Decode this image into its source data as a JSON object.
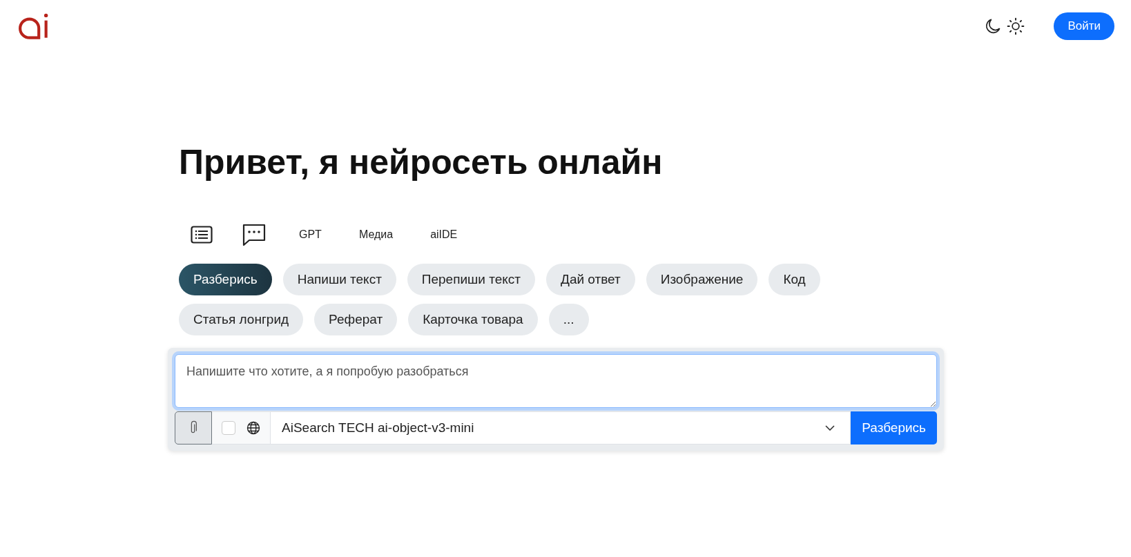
{
  "header": {
    "login_button": "Войти"
  },
  "heading": "Привет, я нейросеть онлайн",
  "mode_tabs": [
    {
      "kind": "list",
      "selected": false
    },
    {
      "kind": "chat",
      "selected": false
    },
    {
      "kind": "text",
      "label": "GPT",
      "selected": false
    },
    {
      "kind": "text",
      "label": "Медиа",
      "selected": false
    },
    {
      "kind": "text",
      "label": "aiIDE",
      "selected": false
    }
  ],
  "task_chips": [
    {
      "label": "Разберись",
      "selected": true
    },
    {
      "label": "Напиши текст",
      "selected": false
    },
    {
      "label": "Перепиши текст",
      "selected": false
    },
    {
      "label": "Дай ответ",
      "selected": false
    },
    {
      "label": "Изображение",
      "selected": false
    },
    {
      "label": "Код",
      "selected": false
    },
    {
      "label": "Статья лонгрид",
      "selected": false
    },
    {
      "label": "Реферат",
      "selected": false
    },
    {
      "label": "Карточка товара",
      "selected": false
    },
    {
      "label": "...",
      "selected": false
    }
  ],
  "composer": {
    "placeholder": "Напишите что хотите, а я попробую разобраться",
    "web_search_checked": false,
    "model": "AiSearch TECH ai-object-v3-mini",
    "submit_button": "Разберись"
  }
}
